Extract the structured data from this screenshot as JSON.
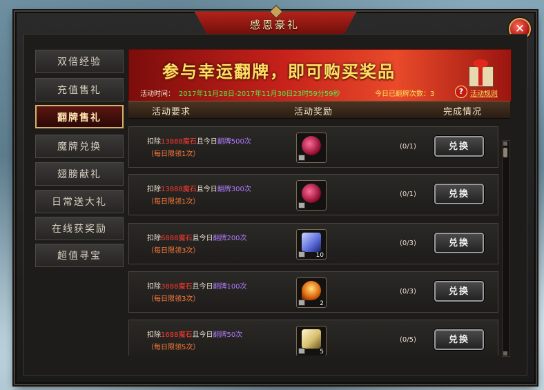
{
  "window": {
    "title": "感恩豪礼",
    "close_label": "✕"
  },
  "sidebar": {
    "items": [
      {
        "label": "双倍经验"
      },
      {
        "label": "充值售礼"
      },
      {
        "label": "翻牌售礼"
      },
      {
        "label": "魔牌兑换"
      },
      {
        "label": "翅膀献礼"
      },
      {
        "label": "日常送大礼"
      },
      {
        "label": "在线获奖励"
      },
      {
        "label": "超值寻宝"
      }
    ],
    "active_index": 2
  },
  "banner": {
    "headline": "参与幸运翻牌，即可购买奖品",
    "time_label": "活动时间：",
    "time_value": "2017年11月28日-2017年11月30日23时59分59秒",
    "flip_count_text": "今日已翻牌次数：3",
    "help_icon": "?",
    "rules_link": "活动规则"
  },
  "columns": {
    "requirement": "活动要求",
    "reward": "活动奖励",
    "status": "完成情况"
  },
  "rows": [
    {
      "prefix": "扣除",
      "cost": "13888魔石",
      "mid": "且今日",
      "flips": "翻牌500次",
      "limit": "（每日限领1次）",
      "qty": "",
      "progress": "(0/1)",
      "button": "兑换",
      "icon": "red-orb-icon",
      "color": "#c0184a"
    },
    {
      "prefix": "扣除",
      "cost": "13888魔石",
      "mid": "且今日",
      "flips": "翻牌300次",
      "limit": "（每日限领1次）",
      "qty": "",
      "progress": "(0/1)",
      "button": "兑换",
      "icon": "red-orb-icon",
      "color": "#c0184a"
    },
    {
      "prefix": "扣除",
      "cost": "6888魔石",
      "mid": "且今日",
      "flips": "翻牌200次",
      "limit": "（每日限领3次）",
      "qty": "10",
      "progress": "(0/3)",
      "button": "兑换",
      "icon": "blue-gift-icon",
      "color": "#5a6ad8"
    },
    {
      "prefix": "扣除",
      "cost": "3888魔石",
      "mid": "且今日",
      "flips": "翻牌100次",
      "limit": "（每日限领3次）",
      "qty": "2",
      "progress": "(0/3)",
      "button": "兑换",
      "icon": "flame-gem-icon",
      "color": "#d86a10"
    },
    {
      "prefix": "扣除",
      "cost": "1688魔石",
      "mid": "且今日",
      "flips": "翻牌50次",
      "limit": "（每日限领5次）",
      "qty": "5",
      "progress": "(0/5)",
      "button": "兑换",
      "icon": "gold-gift-icon",
      "color": "#d8c070"
    }
  ]
}
